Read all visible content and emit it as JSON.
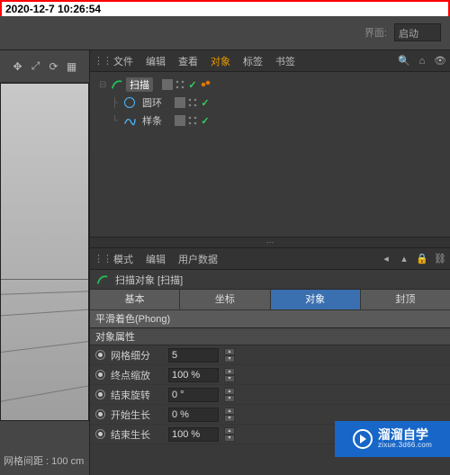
{
  "timestamp": "2020-12-7 10:26:54",
  "top": {
    "layout_label": "界面:",
    "layout_value": "启动"
  },
  "object_panel": {
    "menu": [
      "文件",
      "编辑",
      "查看",
      "对象",
      "标签",
      "书签"
    ],
    "active_index": 3,
    "tree": [
      {
        "name": "扫描",
        "selected": true,
        "kind": "sweep",
        "extra_tag": true,
        "has_checks": true
      },
      {
        "name": "圆环",
        "selected": false,
        "kind": "circle",
        "extra_tag": false,
        "has_checks": true
      },
      {
        "name": "样条",
        "selected": false,
        "kind": "spline",
        "extra_tag": false,
        "has_checks": true
      }
    ]
  },
  "attr_panel": {
    "menu": [
      "模式",
      "编辑",
      "用户数据"
    ],
    "object_title": "扫描对象 [扫描]",
    "tabs": [
      "基本",
      "坐标",
      "对象",
      "封顶"
    ],
    "active_tab": 2,
    "phong": "平滑着色(Phong)",
    "section": "对象属性",
    "props": [
      {
        "label": "网格细分",
        "value": "5"
      },
      {
        "label": "终点缩放",
        "value": "100 %"
      },
      {
        "label": "结束旋转",
        "value": "0 °"
      },
      {
        "label": "开始生长",
        "value": "0 %"
      },
      {
        "label": "结束生长",
        "value": "100 %"
      }
    ]
  },
  "status": "网格间距 : 100 cm",
  "watermark": {
    "main": "溜溜自学",
    "sub": "zixue.3d66.com"
  }
}
